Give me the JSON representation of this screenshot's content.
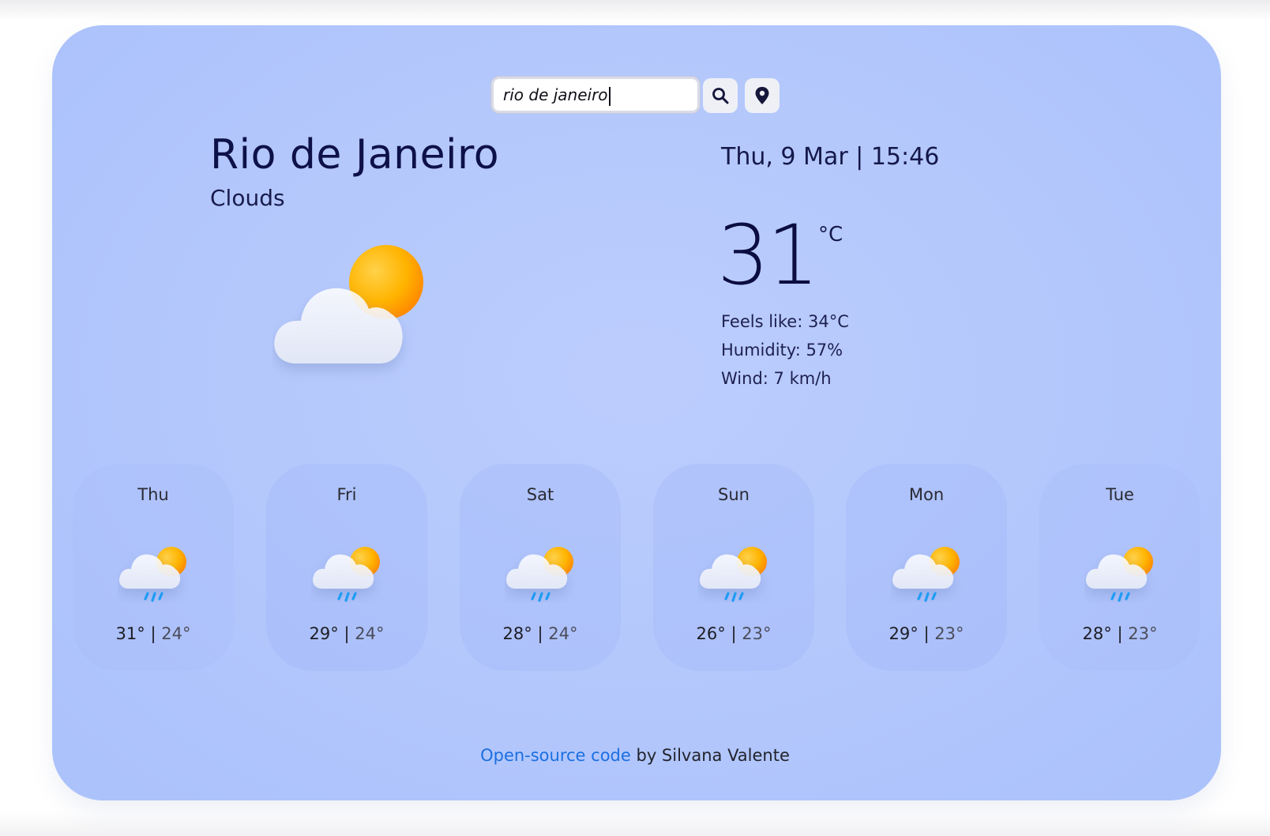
{
  "search": {
    "value": "rio de janeiro"
  },
  "current": {
    "city": "Rio de Janeiro",
    "condition": "Clouds",
    "datetime": "Thu, 9 Mar | 15:46",
    "temperature": "31",
    "unit": "°C",
    "feels_like": "Feels like: 34°C",
    "humidity": "Humidity: 57%",
    "wind": "Wind: 7 km/h",
    "icon": "partly-cloudy-icon"
  },
  "forecast": [
    {
      "day": "Thu",
      "high": "31°",
      "low": "24°",
      "icon": "rain-cloud-sun-icon"
    },
    {
      "day": "Fri",
      "high": "29°",
      "low": "24°",
      "icon": "rain-cloud-sun-icon"
    },
    {
      "day": "Sat",
      "high": "28°",
      "low": "24°",
      "icon": "rain-cloud-sun-icon"
    },
    {
      "day": "Sun",
      "high": "26°",
      "low": "23°",
      "icon": "rain-cloud-sun-icon"
    },
    {
      "day": "Mon",
      "high": "29°",
      "low": "23°",
      "icon": "rain-cloud-sun-icon"
    },
    {
      "day": "Tue",
      "high": "28°",
      "low": "23°",
      "icon": "rain-cloud-sun-icon"
    }
  ],
  "footer": {
    "link_text": "Open-source code",
    "suffix": " by Silvana Valente"
  },
  "colors": {
    "background": "#b3c7fc",
    "text": "#0e1148",
    "link": "#1b6fe0"
  }
}
